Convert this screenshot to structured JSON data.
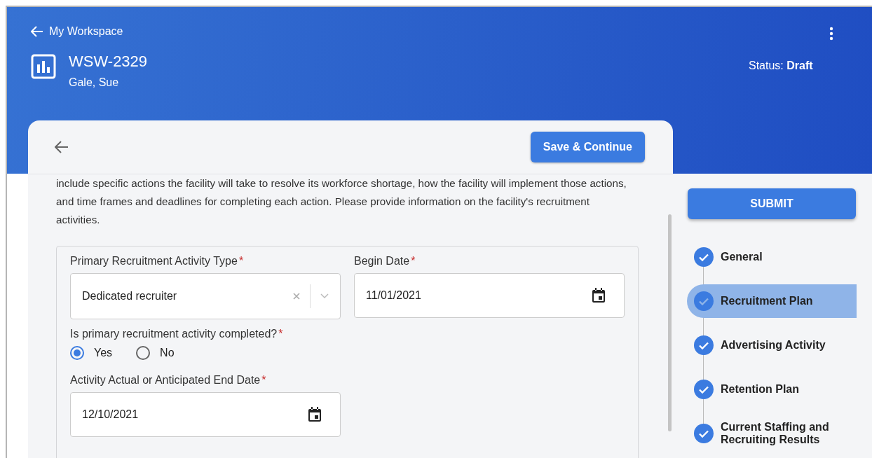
{
  "header": {
    "back_link": "My Workspace",
    "title": "WSW-2329",
    "subtitle": "Gale, Sue",
    "status": "Status: **Draft**"
  },
  "card": {
    "save_button": "Save & Continue",
    "description": "include specific actions the facility will take to resolve its workforce shortage, how the facility will implement those actions, and time frames and deadlines for completing each action. Please provide information on the facility's recruitment activities.",
    "form_rows": [
      [
        {
          "kind": "select",
          "label": "Primary Recruitment Activity Type",
          "required_mark": "*",
          "value": "Dedicated recruiter"
        },
        {
          "kind": "date",
          "label": "Begin Date",
          "required_mark": "*",
          "value": "11/01/2021"
        }
      ],
      [
        {
          "kind": "radio",
          "label": "Is primary recruitment activity completed?",
          "required_mark": "*",
          "options": [
            {
              "label": "Yes",
              "selected": true
            },
            {
              "label": "No",
              "selected": false
            }
          ]
        }
      ],
      [
        {
          "kind": "date",
          "label": "Activity Actual or Anticipated End Date",
          "required_mark": "*",
          "value": "12/10/2021"
        }
      ]
    ]
  },
  "sidebar": {
    "submit_button": "SUBMIT",
    "steps": [
      {
        "label": "General",
        "completed": true,
        "selected": false
      },
      {
        "label": "Recruitment Plan",
        "completed": true,
        "selected": true
      },
      {
        "label": "Advertising Activity",
        "completed": true,
        "selected": false
      },
      {
        "label": "Retention Plan",
        "completed": true,
        "selected": false
      },
      {
        "label": "Current Staffing and Recruiting Results",
        "completed": true,
        "selected": false
      }
    ]
  }
}
